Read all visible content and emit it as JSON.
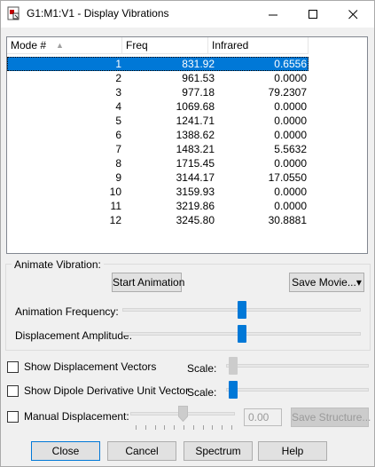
{
  "window": {
    "title": "G1:M1:V1 - Display Vibrations",
    "minimize_label": "—",
    "maximize_label": "☐",
    "close_label": "✕"
  },
  "table": {
    "columns": [
      "Mode #",
      "Freq",
      "Infrared"
    ],
    "sort_indicator": "▲",
    "selected_row": 0,
    "rows": [
      {
        "mode": "1",
        "freq": "831.92",
        "ir": "0.6556"
      },
      {
        "mode": "2",
        "freq": "961.53",
        "ir": "0.0000"
      },
      {
        "mode": "3",
        "freq": "977.18",
        "ir": "79.2307"
      },
      {
        "mode": "4",
        "freq": "1069.68",
        "ir": "0.0000"
      },
      {
        "mode": "5",
        "freq": "1241.71",
        "ir": "0.0000"
      },
      {
        "mode": "6",
        "freq": "1388.62",
        "ir": "0.0000"
      },
      {
        "mode": "7",
        "freq": "1483.21",
        "ir": "5.5632"
      },
      {
        "mode": "8",
        "freq": "1715.45",
        "ir": "0.0000"
      },
      {
        "mode": "9",
        "freq": "3144.17",
        "ir": "17.0550"
      },
      {
        "mode": "10",
        "freq": "3159.93",
        "ir": "0.0000"
      },
      {
        "mode": "11",
        "freq": "3219.86",
        "ir": "0.0000"
      },
      {
        "mode": "12",
        "freq": "3245.80",
        "ir": "30.8881"
      }
    ]
  },
  "animate": {
    "group_label": "Animate Vibration:",
    "start_label": "Start Animation",
    "save_movie_label": "Save Movie...",
    "save_movie_arrow": "▾",
    "frequency_label": "Animation Frequency:",
    "amplitude_label": "Displacement Amplitude:",
    "frequency_level": 0.5,
    "amplitude_level": 0.5
  },
  "vectors": {
    "show_displacement_label": "Show Displacement Vectors",
    "show_dipole_label": "Show Dipole Derivative Unit Vector",
    "scale_label": "Scale:",
    "displacement_checked": false,
    "dipole_checked": false
  },
  "manual": {
    "label": "Manual Displacement:",
    "checked": false,
    "value": "0.00",
    "save_structure_label": "Save Structure..."
  },
  "buttons": {
    "close": "Close",
    "cancel": "Cancel",
    "spectrum": "Spectrum",
    "help": "Help"
  },
  "colors": {
    "selection": "#0078d7",
    "slider_thumb": "#0078d7"
  }
}
